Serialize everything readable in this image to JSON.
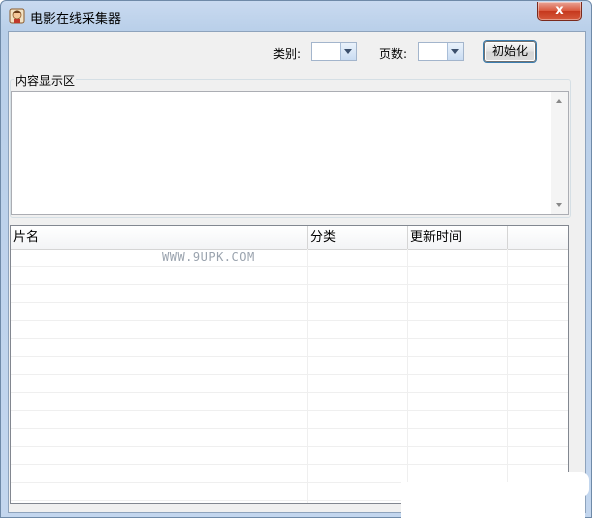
{
  "window": {
    "title": "电影在线采集器",
    "close_label": "x"
  },
  "toolbar": {
    "category_label": "类别:",
    "category_value": "",
    "pages_label": "页数:",
    "pages_value": "",
    "init_button": "初始化"
  },
  "content_group": {
    "title": "内容显示区",
    "text": ""
  },
  "list": {
    "columns": [
      "片名",
      "分类",
      "更新时间"
    ],
    "watermark": "WWW.9UPK.COM",
    "rows": []
  },
  "colors": {
    "title_bar": "#c9daf0",
    "close_button": "#d9573c",
    "client_background": "#f0f0f0"
  }
}
